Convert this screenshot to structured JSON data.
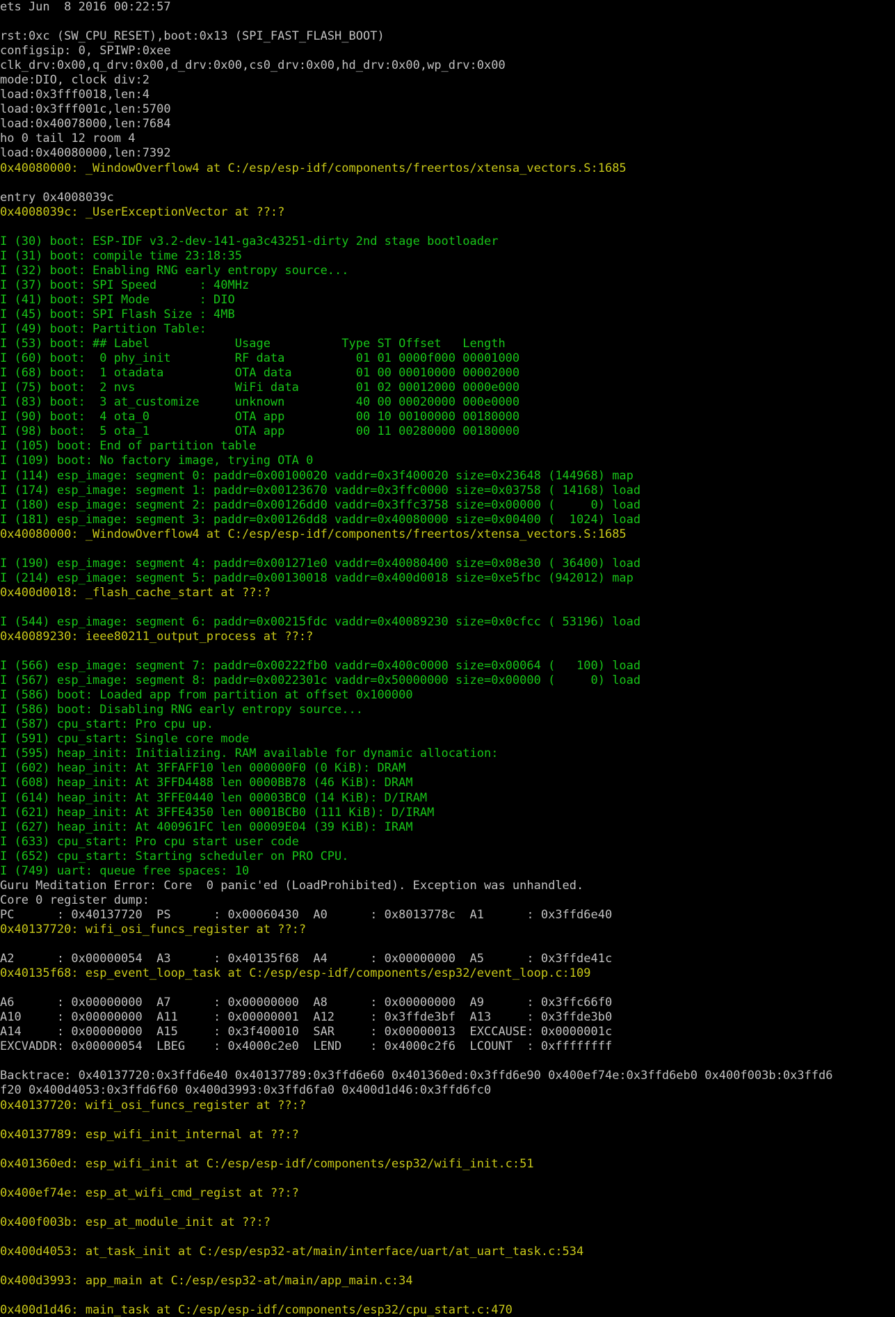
{
  "terminal": {
    "colors": {
      "background": "#000000",
      "white": "#c0c0c0",
      "green": "#18c418",
      "yellow": "#c8c818"
    },
    "lines": [
      {
        "t": "ets Jun  8 2016 00:22:57",
        "c": "white"
      },
      {
        "t": "",
        "c": "white"
      },
      {
        "t": "rst:0xc (SW_CPU_RESET),boot:0x13 (SPI_FAST_FLASH_BOOT)",
        "c": "white"
      },
      {
        "t": "configsip: 0, SPIWP:0xee",
        "c": "white"
      },
      {
        "t": "clk_drv:0x00,q_drv:0x00,d_drv:0x00,cs0_drv:0x00,hd_drv:0x00,wp_drv:0x00",
        "c": "white"
      },
      {
        "t": "mode:DIO, clock div:2",
        "c": "white"
      },
      {
        "t": "load:0x3fff0018,len:4",
        "c": "white"
      },
      {
        "t": "load:0x3fff001c,len:5700",
        "c": "white"
      },
      {
        "t": "load:0x40078000,len:7684",
        "c": "white"
      },
      {
        "t": "ho 0 tail 12 room 4",
        "c": "white"
      },
      {
        "t": "load:0x40080000,len:7392",
        "c": "white"
      },
      {
        "t": "0x40080000: _WindowOverflow4 at C:/esp/esp-idf/components/freertos/xtensa_vectors.S:1685",
        "c": "yellow"
      },
      {
        "t": "",
        "c": "white"
      },
      {
        "t": "entry 0x4008039c",
        "c": "white"
      },
      {
        "t": "0x4008039c: _UserExceptionVector at ??:?",
        "c": "yellow"
      },
      {
        "t": "",
        "c": "white"
      },
      {
        "t": "I (30) boot: ESP-IDF v3.2-dev-141-ga3c43251-dirty 2nd stage bootloader",
        "c": "green"
      },
      {
        "t": "I (31) boot: compile time 23:18:35",
        "c": "green"
      },
      {
        "t": "I (32) boot: Enabling RNG early entropy source...",
        "c": "green"
      },
      {
        "t": "I (37) boot: SPI Speed      : 40MHz",
        "c": "green"
      },
      {
        "t": "I (41) boot: SPI Mode       : DIO",
        "c": "green"
      },
      {
        "t": "I (45) boot: SPI Flash Size : 4MB",
        "c": "green"
      },
      {
        "t": "I (49) boot: Partition Table:",
        "c": "green"
      },
      {
        "t": "I (53) boot: ## Label            Usage          Type ST Offset   Length",
        "c": "green"
      },
      {
        "t": "I (60) boot:  0 phy_init         RF data          01 01 0000f000 00001000",
        "c": "green"
      },
      {
        "t": "I (68) boot:  1 otadata          OTA data         01 00 00010000 00002000",
        "c": "green"
      },
      {
        "t": "I (75) boot:  2 nvs              WiFi data        01 02 00012000 0000e000",
        "c": "green"
      },
      {
        "t": "I (83) boot:  3 at_customize     unknown          40 00 00020000 000e0000",
        "c": "green"
      },
      {
        "t": "I (90) boot:  4 ota_0            OTA app          00 10 00100000 00180000",
        "c": "green"
      },
      {
        "t": "I (98) boot:  5 ota_1            OTA app          00 11 00280000 00180000",
        "c": "green"
      },
      {
        "t": "I (105) boot: End of partition table",
        "c": "green"
      },
      {
        "t": "I (109) boot: No factory image, trying OTA 0",
        "c": "green"
      },
      {
        "t": "I (114) esp_image: segment 0: paddr=0x00100020 vaddr=0x3f400020 size=0x23648 (144968) map",
        "c": "green"
      },
      {
        "t": "I (174) esp_image: segment 1: paddr=0x00123670 vaddr=0x3ffc0000 size=0x03758 ( 14168) load",
        "c": "green"
      },
      {
        "t": "I (180) esp_image: segment 2: paddr=0x00126dd0 vaddr=0x3ffc3758 size=0x00000 (     0) load",
        "c": "green"
      },
      {
        "t": "I (181) esp_image: segment 3: paddr=0x00126dd8 vaddr=0x40080000 size=0x00400 (  1024) load",
        "c": "green"
      },
      {
        "t": "0x40080000: _WindowOverflow4 at C:/esp/esp-idf/components/freertos/xtensa_vectors.S:1685",
        "c": "yellow"
      },
      {
        "t": "",
        "c": "white"
      },
      {
        "t": "I (190) esp_image: segment 4: paddr=0x001271e0 vaddr=0x40080400 size=0x08e30 ( 36400) load",
        "c": "green"
      },
      {
        "t": "I (214) esp_image: segment 5: paddr=0x00130018 vaddr=0x400d0018 size=0xe5fbc (942012) map",
        "c": "green"
      },
      {
        "t": "0x400d0018: _flash_cache_start at ??:?",
        "c": "yellow"
      },
      {
        "t": "",
        "c": "white"
      },
      {
        "t": "I (544) esp_image: segment 6: paddr=0x00215fdc vaddr=0x40089230 size=0x0cfcc ( 53196) load",
        "c": "green"
      },
      {
        "t": "0x40089230: ieee80211_output_process at ??:?",
        "c": "yellow"
      },
      {
        "t": "",
        "c": "white"
      },
      {
        "t": "I (566) esp_image: segment 7: paddr=0x00222fb0 vaddr=0x400c0000 size=0x00064 (   100) load",
        "c": "green"
      },
      {
        "t": "I (567) esp_image: segment 8: paddr=0x0022301c vaddr=0x50000000 size=0x00000 (     0) load",
        "c": "green"
      },
      {
        "t": "I (586) boot: Loaded app from partition at offset 0x100000",
        "c": "green"
      },
      {
        "t": "I (586) boot: Disabling RNG early entropy source...",
        "c": "green"
      },
      {
        "t": "I (587) cpu_start: Pro cpu up.",
        "c": "green"
      },
      {
        "t": "I (591) cpu_start: Single core mode",
        "c": "green"
      },
      {
        "t": "I (595) heap_init: Initializing. RAM available for dynamic allocation:",
        "c": "green"
      },
      {
        "t": "I (602) heap_init: At 3FFAFF10 len 000000F0 (0 KiB): DRAM",
        "c": "green"
      },
      {
        "t": "I (608) heap_init: At 3FFD4488 len 0000BB78 (46 KiB): DRAM",
        "c": "green"
      },
      {
        "t": "I (614) heap_init: At 3FFE0440 len 00003BC0 (14 KiB): D/IRAM",
        "c": "green"
      },
      {
        "t": "I (621) heap_init: At 3FFE4350 len 0001BCB0 (111 KiB): D/IRAM",
        "c": "green"
      },
      {
        "t": "I (627) heap_init: At 400961FC len 00009E04 (39 KiB): IRAM",
        "c": "green"
      },
      {
        "t": "I (633) cpu_start: Pro cpu start user code",
        "c": "green"
      },
      {
        "t": "I (652) cpu_start: Starting scheduler on PRO CPU.",
        "c": "green"
      },
      {
        "t": "I (749) uart: queue free spaces: 10",
        "c": "green"
      },
      {
        "t": "Guru Meditation Error: Core  0 panic'ed (LoadProhibited). Exception was unhandled.",
        "c": "white"
      },
      {
        "t": "Core 0 register dump:",
        "c": "white"
      },
      {
        "t": "PC      : 0x40137720  PS      : 0x00060430  A0      : 0x8013778c  A1      : 0x3ffd6e40",
        "c": "white"
      },
      {
        "t": "0x40137720: wifi_osi_funcs_register at ??:?",
        "c": "yellow"
      },
      {
        "t": "",
        "c": "white"
      },
      {
        "t": "A2      : 0x00000054  A3      : 0x40135f68  A4      : 0x00000000  A5      : 0x3ffde41c",
        "c": "white"
      },
      {
        "t": "0x40135f68: esp_event_loop_task at C:/esp/esp-idf/components/esp32/event_loop.c:109",
        "c": "yellow"
      },
      {
        "t": "",
        "c": "white"
      },
      {
        "t": "A6      : 0x00000000  A7      : 0x00000000  A8      : 0x00000000  A9      : 0x3ffc66f0",
        "c": "white"
      },
      {
        "t": "A10     : 0x00000000  A11     : 0x00000001  A12     : 0x3ffde3bf  A13     : 0x3ffde3b0",
        "c": "white"
      },
      {
        "t": "A14     : 0x00000000  A15     : 0x3f400010  SAR     : 0x00000013  EXCCAUSE: 0x0000001c",
        "c": "white"
      },
      {
        "t": "EXCVADDR: 0x00000054  LBEG    : 0x4000c2e0  LEND    : 0x4000c2f6  LCOUNT  : 0xffffffff",
        "c": "white"
      },
      {
        "t": "",
        "c": "white"
      },
      {
        "t": "Backtrace: 0x40137720:0x3ffd6e40 0x40137789:0x3ffd6e60 0x401360ed:0x3ffd6e90 0x400ef74e:0x3ffd6eb0 0x400f003b:0x3ffd6",
        "c": "white"
      },
      {
        "t": "f20 0x400d4053:0x3ffd6f60 0x400d3993:0x3ffd6fa0 0x400d1d46:0x3ffd6fc0",
        "c": "white"
      },
      {
        "t": "0x40137720: wifi_osi_funcs_register at ??:?",
        "c": "yellow"
      },
      {
        "t": "",
        "c": "white"
      },
      {
        "t": "0x40137789: esp_wifi_init_internal at ??:?",
        "c": "yellow"
      },
      {
        "t": "",
        "c": "white"
      },
      {
        "t": "0x401360ed: esp_wifi_init at C:/esp/esp-idf/components/esp32/wifi_init.c:51",
        "c": "yellow"
      },
      {
        "t": "",
        "c": "white"
      },
      {
        "t": "0x400ef74e: esp_at_wifi_cmd_regist at ??:?",
        "c": "yellow"
      },
      {
        "t": "",
        "c": "white"
      },
      {
        "t": "0x400f003b: esp_at_module_init at ??:?",
        "c": "yellow"
      },
      {
        "t": "",
        "c": "white"
      },
      {
        "t": "0x400d4053: at_task_init at C:/esp/esp32-at/main/interface/uart/at_uart_task.c:534",
        "c": "yellow"
      },
      {
        "t": "",
        "c": "white"
      },
      {
        "t": "0x400d3993: app_main at C:/esp/esp32-at/main/app_main.c:34",
        "c": "yellow"
      },
      {
        "t": "",
        "c": "white"
      },
      {
        "t": "0x400d1d46: main_task at C:/esp/esp-idf/components/esp32/cpu_start.c:470",
        "c": "yellow"
      }
    ]
  }
}
